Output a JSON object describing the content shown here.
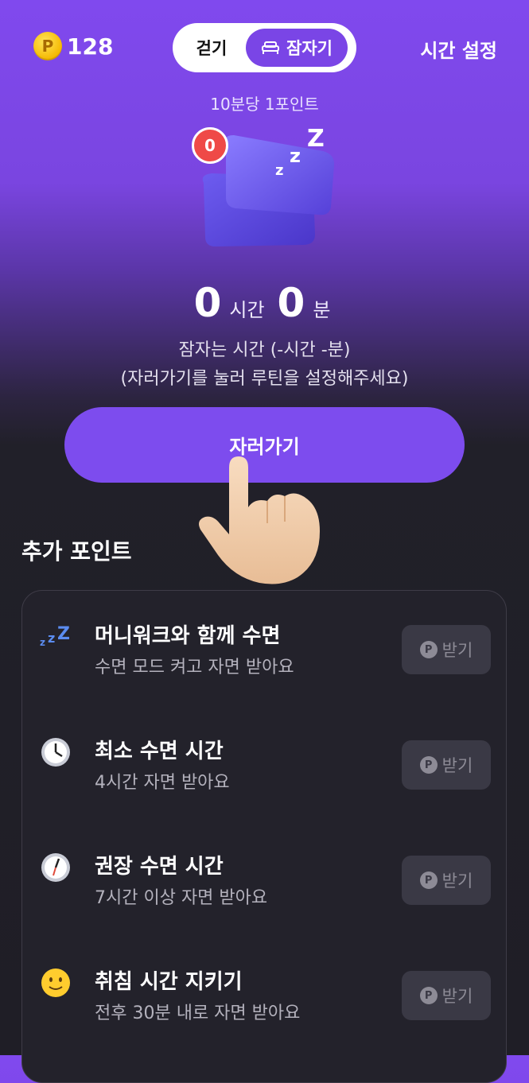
{
  "header": {
    "points": "128",
    "coin_symbol": "P",
    "toggle": {
      "walk_label": "걷기",
      "sleep_label": "잠자기"
    },
    "time_setting_label": "시간 설정"
  },
  "rate_label": "10분당 1포인트",
  "badge_count": "0",
  "timer": {
    "hours": "0",
    "hours_unit": "시간",
    "minutes": "0",
    "minutes_unit": "분"
  },
  "info_line1": "잠자는 시간 (-시간 -분)",
  "info_line2": "(자러가기를 눌러 루틴을 설정해주세요)",
  "go_button_label": "자러가기",
  "section_title": "추가 포인트",
  "rewards": [
    {
      "icon": "zzz-icon",
      "title": "머니워크와 함께 수면",
      "subtitle": "수면 모드 켜고 자면 받아요",
      "button": "받기"
    },
    {
      "icon": "clock-icon",
      "title": "최소 수면 시간",
      "subtitle": "4시간 자면 받아요",
      "button": "받기"
    },
    {
      "icon": "clock-icon",
      "title": "권장 수면 시간",
      "subtitle": "7시간 이상 자면 받아요",
      "button": "받기"
    },
    {
      "icon": "smiley-icon",
      "title": "취침 시간 지키기",
      "subtitle": "전후 30분 내로 자면 받아요",
      "button": "받기"
    }
  ],
  "colors": {
    "accent": "#7d4cee",
    "badge": "#ef4a47",
    "background": "#1f1e26"
  }
}
